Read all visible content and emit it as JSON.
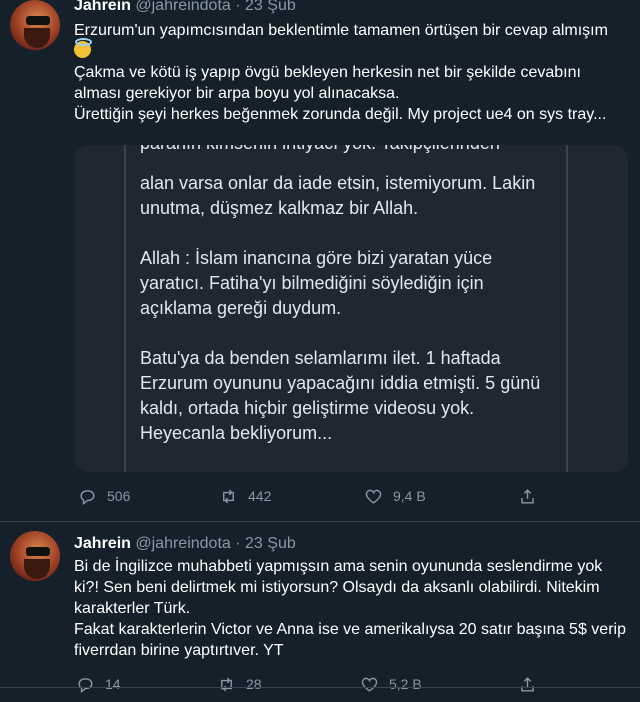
{
  "tweets": [
    {
      "author": "Jahrein",
      "handle": "@jahreindota",
      "date": "23 Şub",
      "lines": [
        "Erzurum'un yapımcısından beklentimle tamamen örtüşen bir cevap almışım",
        "Çakma ve kötü iş yapıp övgü bekleyen herkesin net bir şekilde cevabını alması gerekiyor bir arpa boyu yol alınacaksa.",
        "Ürettiğin şeyi herkes beğenmek zorunda değil. My project ue4 on sys tray..."
      ],
      "emoji": "smiling-face-with-halo",
      "media": {
        "cut_line": "paranın kimsenin ihtiyacı yok. Takipçilerinden",
        "paragraphs": [
          "alan varsa onlar da iade etsin, istemiyorum. Lakin unutma, düşmez kalkmaz bir Allah.",
          "Allah : İslam inancına göre bizi yaratan yüce yaratıcı. Fatiha'yı bilmediğini söylediğin için açıklama gereği duydum.",
          "Batu'ya da benden selamlarımı ilet. 1 haftada Erzurum oyununu yapacağını iddia etmişti. 5 günü kaldı, ortada hiçbir geliştirme videosu yok. Heyecanla bekliyorum..."
        ]
      },
      "replies": "506",
      "retweets": "442",
      "likes": "9,4 B"
    },
    {
      "author": "Jahrein",
      "handle": "@jahreindota",
      "date": "23 Şub",
      "lines": [
        "Bi de İngilizce muhabbeti yapmışsın ama senin oyununda seslendirme yok ki?! Sen beni delirtmek mi istiyorsun? Olsaydı da aksanlı olabilirdi. Nitekim karakterler Türk.",
        "Fakat karakterlerin Victor ve Anna ise ve amerikalıysa 20 satır başına 5$ verip fiverrdan birine yaptırtıver. YT"
      ],
      "replies": "14",
      "retweets": "28",
      "likes": "5,2 B"
    }
  ],
  "colors": {
    "background": "#15202b",
    "text": "#ffffff",
    "muted": "#8899a6",
    "media_bg": "#1e2732",
    "separator": "#38444d"
  },
  "icons": [
    "reply-icon",
    "retweet-icon",
    "like-icon",
    "share-icon"
  ]
}
